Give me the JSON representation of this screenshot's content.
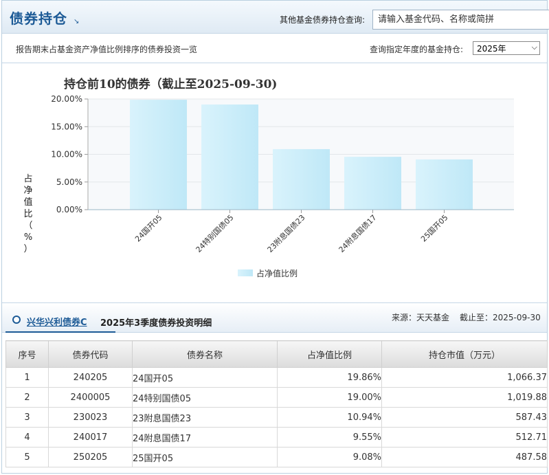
{
  "header": {
    "title": "债券持仓",
    "arrow": "↘",
    "query_label": "其他基金债券持仓查询:",
    "search_placeholder": "请输入基金代码、名称或简拼"
  },
  "subheader": {
    "description": "报告期末占基金资产净值比例排序的债券投资一览",
    "year_label": "查询指定年度的基金持仓:",
    "year_value": "2025年"
  },
  "chart_data": {
    "type": "bar",
    "title": "持仓前10的债券（截止至2025-09-30)",
    "ylabel": "占净值比（%）",
    "categories": [
      "24国开05",
      "24特别国债05",
      "23附息国债23",
      "24附息国债17",
      "25国开05"
    ],
    "series": [
      {
        "name": "占净值比例",
        "values": [
          19.86,
          19.0,
          10.94,
          9.55,
          9.08
        ]
      }
    ],
    "ylim": [
      0,
      20
    ],
    "yticks": [
      "0.00%",
      "5.00%",
      "10.00%",
      "15.00%",
      "20.00%"
    ],
    "legend": "bottom-center",
    "grid": true,
    "bar_color": "#bfe8f7"
  },
  "detail": {
    "fund_name": "兴华兴利债券C",
    "title": "2025年3季度债券投资明细",
    "source": "来源：天天基金",
    "date": "截止至：2025-09-30",
    "columns": [
      "序号",
      "债券代码",
      "债券名称",
      "占净值比例",
      "持仓市值（万元）"
    ],
    "rows": [
      {
        "no": "1",
        "code": "240205",
        "name": "24国开05",
        "ratio": "19.86%",
        "value": "1,066.37"
      },
      {
        "no": "2",
        "code": "2400005",
        "name": "24特别国债05",
        "ratio": "19.00%",
        "value": "1,019.88"
      },
      {
        "no": "3",
        "code": "230023",
        "name": "23附息国债23",
        "ratio": "10.94%",
        "value": "587.43"
      },
      {
        "no": "4",
        "code": "240017",
        "name": "24附息国债17",
        "ratio": "9.55%",
        "value": "512.71"
      },
      {
        "no": "5",
        "code": "250205",
        "name": "25国开05",
        "ratio": "9.08%",
        "value": "487.58"
      }
    ]
  },
  "colors": {
    "brand": "#1c5a96",
    "bar": "#bfe8f7"
  }
}
